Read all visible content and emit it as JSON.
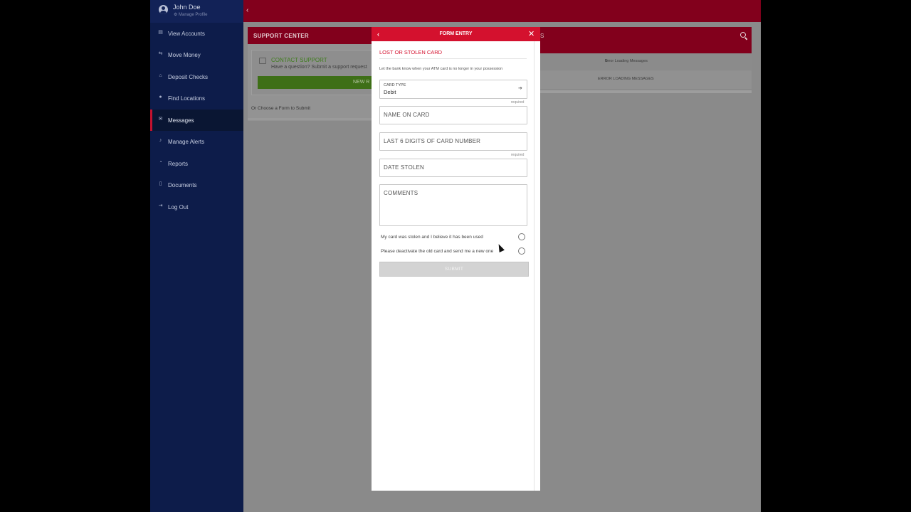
{
  "profile": {
    "name": "John Doe",
    "manage": "Manage Profile"
  },
  "sidebar": {
    "items": [
      {
        "label": "View Accounts",
        "icon": "accounts-icon"
      },
      {
        "label": "Move Money",
        "icon": "transfer-icon"
      },
      {
        "label": "Deposit Checks",
        "icon": "bank-icon"
      },
      {
        "label": "Find Locations",
        "icon": "location-pin-icon"
      },
      {
        "label": "Messages",
        "icon": "envelope-icon",
        "active": true
      },
      {
        "label": "Manage Alerts",
        "icon": "bell-icon"
      },
      {
        "label": "Reports",
        "icon": "pie-chart-icon"
      },
      {
        "label": "Documents",
        "icon": "document-icon"
      },
      {
        "label": "Log Out",
        "icon": "logout-icon"
      }
    ]
  },
  "support": {
    "title": "SUPPORT CENTER",
    "contact_title": "CONTACT SUPPORT",
    "contact_sub": "Have a question? Submit a support request",
    "new_request": "NEW R",
    "choose_form": "Or Choose a Form to Submit"
  },
  "messages_panel": {
    "title_fragment": "S",
    "error_banner": "Error Loading Messages",
    "error_body": "ERROR LOADING MESSAGES"
  },
  "modal": {
    "header": "FORM ENTRY",
    "heading": "LOST OR STOLEN CARD",
    "description": "Let the bank know when your ATM card is no longer in your possession",
    "card_type": {
      "label": "CARD TYPE",
      "value": "Debit"
    },
    "fields": {
      "name_on_card": "NAME ON CARD",
      "last6": "LAST 6 DIGITS OF CARD NUMBER",
      "date_stolen": "DATE STOLEN",
      "comments": "COMMENTS"
    },
    "required": "required",
    "options": {
      "used": "My card was stolen and I believe it has been used",
      "deactivate": "Please deactivate the old card and send me a new one"
    },
    "submit": "SUBMIT"
  },
  "colors": {
    "brand_red": "#d4112e",
    "nav_blue": "#0d1c4a",
    "support_green": "#5ba52a"
  }
}
